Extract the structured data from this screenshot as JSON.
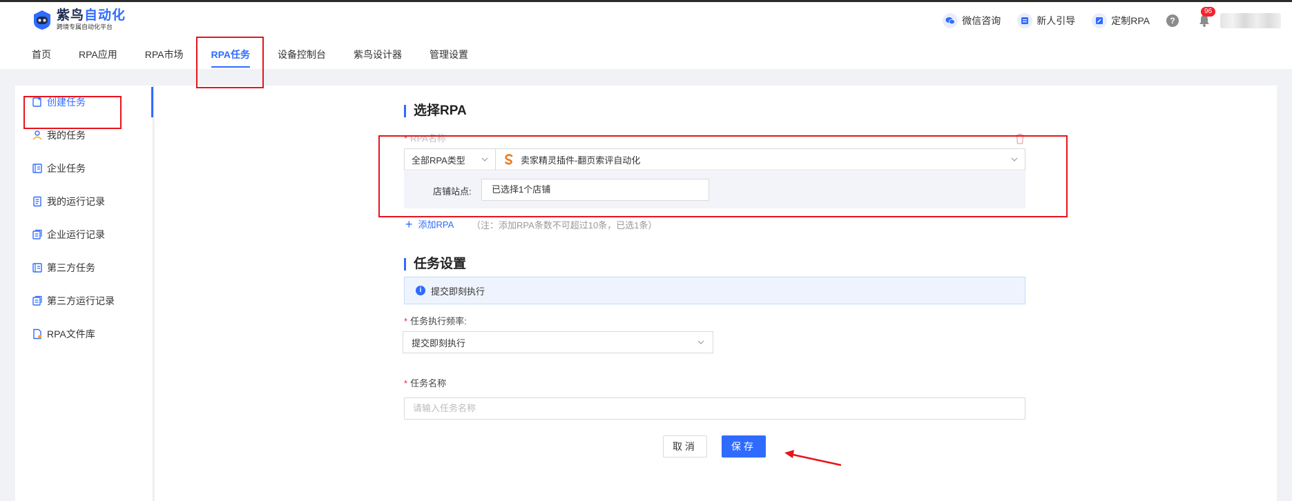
{
  "brand": {
    "title_part1": "紫鸟",
    "title_part2": "自动化",
    "subtitle": "跨境专属自动化平台"
  },
  "nav": {
    "items": [
      "首页",
      "RPA应用",
      "RPA市场",
      "RPA任务",
      "设备控制台",
      "紫鸟设计器",
      "管理设置"
    ],
    "active_index": 3
  },
  "header_right": {
    "wechat": "微信咨询",
    "guide": "新人引导",
    "custom_rpa": "定制RPA",
    "help": "?",
    "notifications": "96"
  },
  "sidebar": {
    "items": [
      "创建任务",
      "我的任务",
      "企业任务",
      "我的运行记录",
      "企业运行记录",
      "第三方任务",
      "第三方运行记录",
      "RPA文件库"
    ],
    "active_index": 0
  },
  "select_rpa": {
    "title": "选择RPA",
    "name_label": "RPA名称",
    "type_value": "全部RPA类型",
    "rpa_value": "卖家精灵插件-翻页索评自动化",
    "store_label": "店铺站点:",
    "store_value": "已选择1个店铺",
    "add_label": "添加RPA",
    "add_note": "（注：添加RPA条数不可超过10条，已选1条）"
  },
  "task_settings": {
    "title": "任务设置",
    "info_text": "提交即刻执行",
    "frequency_label": "任务执行频率:",
    "frequency_value": "提交即刻执行",
    "task_name_label": "任务名称",
    "task_name_placeholder": "请输入任务名称"
  },
  "actions": {
    "cancel": "取消",
    "save": "保存"
  },
  "colors": {
    "accent": "#2f6bff",
    "highlight": "#e8121b",
    "danger": "#f5222d"
  }
}
